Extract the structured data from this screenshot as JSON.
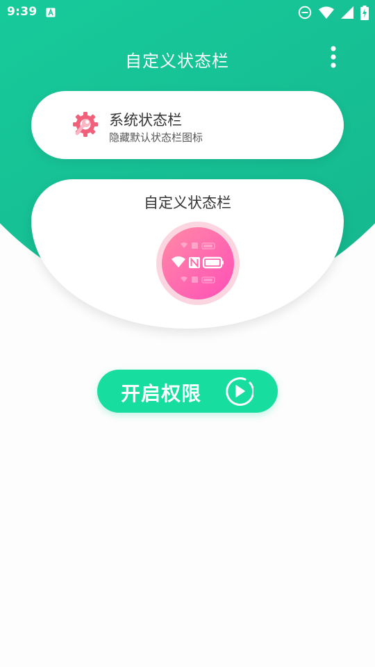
{
  "status_bar": {
    "time": "9:39",
    "icons": [
      "app-notification-icon",
      "do-not-disturb-icon",
      "wifi-icon",
      "cell-signal-icon",
      "battery-charging-icon"
    ]
  },
  "toolbar": {
    "title": "自定义状态栏",
    "overflow_icon": "more-vertical-icon"
  },
  "system_card": {
    "icon": "gear-wrench-icon",
    "title": "系统状态栏",
    "subtitle": "隐藏默认状态栏图标"
  },
  "custom_card": {
    "title": "自定义状态栏",
    "preview_icon": "status-bar-preview-icon"
  },
  "permission_button": {
    "label": "开启权限",
    "icon": "play-circle-icon"
  },
  "colors": {
    "header_start": "#1ee3a6",
    "header_end": "#15b48c",
    "button": "#17dd9f",
    "gear_pink": "#f0607a",
    "preview_pink": "#ff5ab0"
  }
}
